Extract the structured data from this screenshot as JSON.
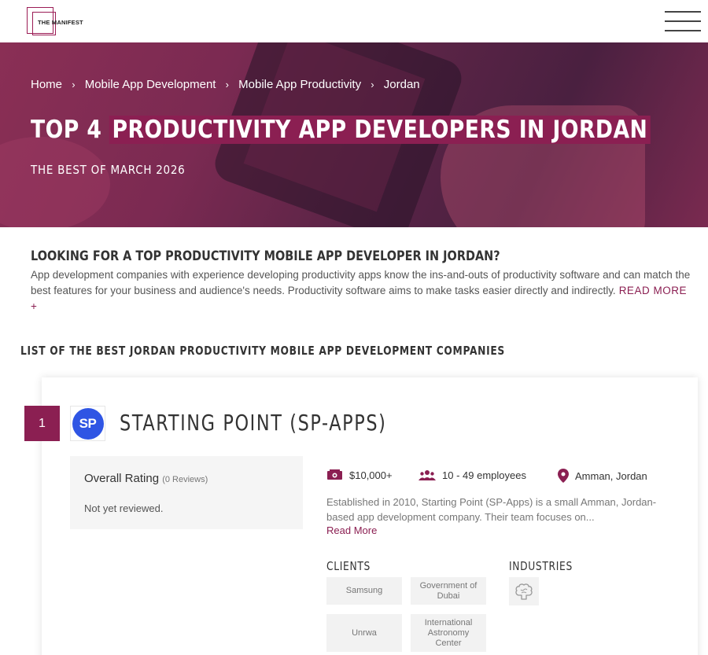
{
  "header": {
    "logo_text": "THE MANIFEST"
  },
  "hero": {
    "breadcrumb": [
      "Home",
      "Mobile App Development",
      "Mobile App Productivity",
      "Jordan"
    ],
    "breadcrumb_separator": "›",
    "title_prefix": "TOP 4 ",
    "title_highlight": "PRODUCTIVITY APP DEVELOPERS IN JORDAN",
    "subtitle": "THE BEST OF MARCH 2026"
  },
  "intro": {
    "title": "LOOKING FOR A TOP PRODUCTIVITY MOBILE APP DEVELOPER IN JORDAN?",
    "body": "App development companies with experience developing productivity apps know the ins-and-outs of productivity software and can match the best features for your business and audience's needs. Productivity software aims to make tasks easier directly and indirectly.",
    "read_more": "READ MORE +"
  },
  "list": {
    "title": "LIST OF THE BEST JORDAN PRODUCTIVITY MOBILE APP DEVELOPMENT COMPANIES"
  },
  "company": {
    "rank": "1",
    "logo_text": "SP",
    "logo_color": "#2f55e4",
    "name": "STARTING POINT (SP-APPS)",
    "rating_label": "Overall Rating",
    "reviews": "(0 Reviews)",
    "not_reviewed": "Not yet reviewed.",
    "min_project": "$10,000+",
    "employees": "10 - 49 employees",
    "location": "Amman, Jordan",
    "description": "Established in 2010, Starting Point (SP-Apps) is a small Amman, Jordan-based app development company. Their team focuses on...",
    "read_more": "Read More",
    "clients_label": "CLIENTS",
    "industries_label": "INDUSTRIES",
    "clients": [
      "Samsung",
      "Government of Dubai",
      "Unrwa",
      "International Astronomy Center"
    ]
  },
  "colors": {
    "accent": "#8b1f52"
  }
}
